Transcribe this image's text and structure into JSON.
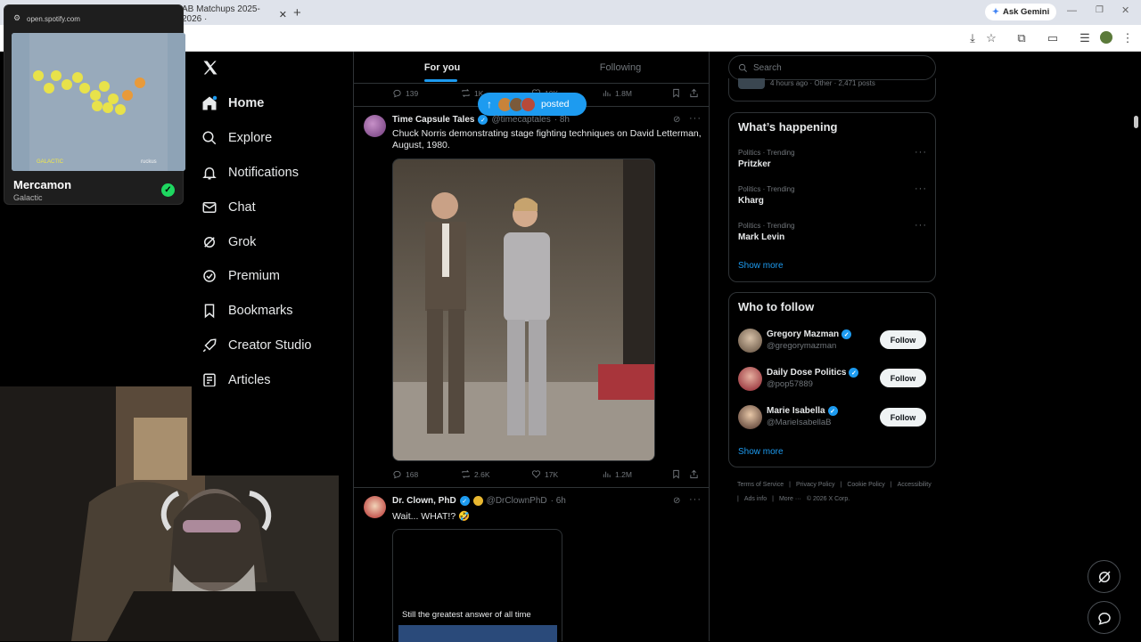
{
  "browser": {
    "spotify_tab_url": "open.spotify.com",
    "tab2_title": "AB Matchups 2025-2026 ·",
    "gemini_label": "Ask Gemini"
  },
  "spotify": {
    "url": "open.spotify.com",
    "track": "Mercamon",
    "artist": "Galactic",
    "art_text_left": "GALACTIC",
    "art_text_right": "ruckus"
  },
  "nav": {
    "items": [
      {
        "label": "Home",
        "icon": "home-icon"
      },
      {
        "label": "Explore",
        "icon": "search-icon"
      },
      {
        "label": "Notifications",
        "icon": "bell-icon"
      },
      {
        "label": "Chat",
        "icon": "mail-icon"
      },
      {
        "label": "Grok",
        "icon": "grok-icon"
      },
      {
        "label": "Premium",
        "icon": "premium-icon"
      },
      {
        "label": "Bookmarks",
        "icon": "bookmark-icon"
      },
      {
        "label": "Creator Studio",
        "icon": "rocket-icon"
      },
      {
        "label": "Articles",
        "icon": "article-icon"
      }
    ]
  },
  "feed": {
    "tabs": [
      "For you",
      "Following"
    ],
    "posted_pill": "posted",
    "top_actions": {
      "replies": "139",
      "reposts": "1K",
      "likes": "10K",
      "views": "1.8M"
    },
    "post1": {
      "name": "Time Capsule Tales",
      "handle": "@timecaptales",
      "time": "· 8h",
      "text": "Chuck Norris demonstrating stage fighting techniques on David Letterman, August, 1980.",
      "replies": "168",
      "reposts": "2.6K",
      "likes": "17K",
      "views": "1.2M"
    },
    "post2": {
      "name": "Dr. Clown, PhD",
      "handle": "@DrClownPhD",
      "time": "· 6h",
      "text": "Wait... WHAT!? 🤣",
      "media_caption": "Still the greatest answer of all time"
    }
  },
  "right": {
    "search_placeholder": "Search",
    "top_card_meta": "4 hours ago · Other · 2,471 posts",
    "whats_happening": "What’s happening",
    "trends": [
      {
        "category": "Politics · Trending",
        "name": "Pritzker"
      },
      {
        "category": "Politics · Trending",
        "name": "Kharg"
      },
      {
        "category": "Politics · Trending",
        "name": "Mark Levin"
      }
    ],
    "show_more": "Show more",
    "who_to_follow": "Who to follow",
    "follows": [
      {
        "name": "Gregory Mazman",
        "handle": "@gregorymazman"
      },
      {
        "name": "Daily Dose Politics",
        "handle": "@pop57889"
      },
      {
        "name": "Marie Isabella",
        "handle": "@MarieIsabellaB"
      }
    ],
    "follow_label": "Follow",
    "footer": {
      "terms": "Terms of Service",
      "privacy": "Privacy Policy",
      "cookie": "Cookie Policy",
      "accessibility": "Accessibility",
      "ads": "Ads info",
      "more": "More ···",
      "copyright": "© 2026 X Corp."
    }
  },
  "colors": {
    "accent": "#1d9bf0",
    "bg": "#000000",
    "border": "#2f3336"
  }
}
